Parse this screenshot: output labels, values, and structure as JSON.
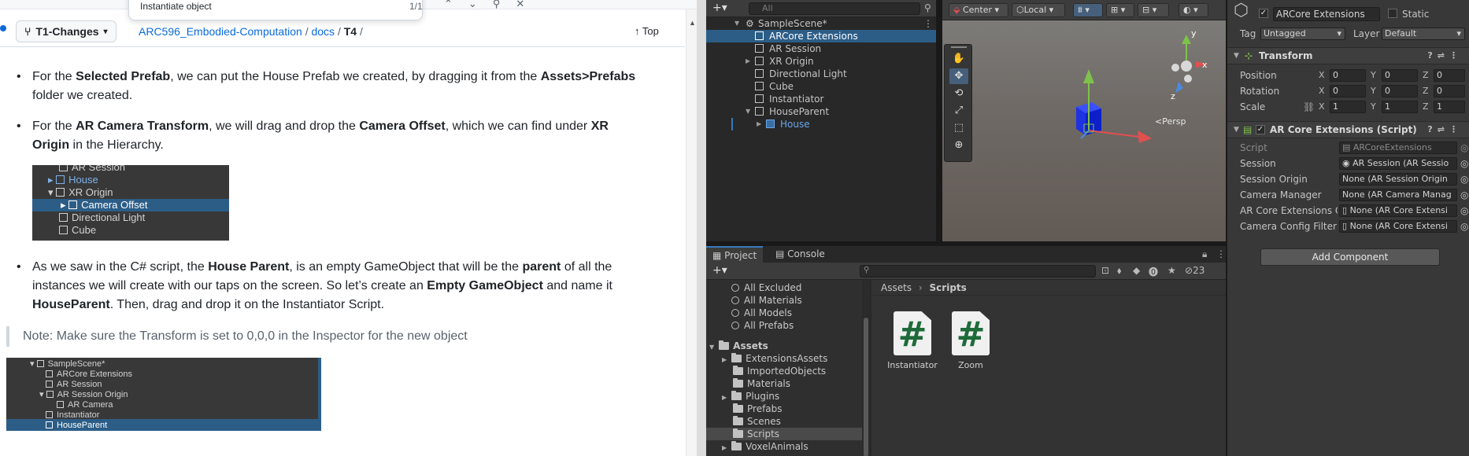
{
  "findbar": {
    "query": "Instantiate object",
    "count": "1/1"
  },
  "gh": {
    "branch": "T1-Changes",
    "repo": "ARC596_Embodied-Computation",
    "sep1": "/",
    "folder": "docs",
    "sep2": "/",
    "file": "T4",
    "sep3": "/",
    "top_label": "Top",
    "para1": {
      "pre": "For the ",
      "b1": "Selected Prefab",
      "mid": ", we can put the House Prefab we created, by dragging it from the ",
      "b2": "Assets>Prefabs",
      "post": " folder we created."
    },
    "para2": {
      "pre": "For the ",
      "b1": "AR Camera Transform",
      "mid": ", we will drag and drop the ",
      "b2": "Camera Offset",
      "mid2": ", which we can find under ",
      "b3": "XR Origin",
      "post": " in the Hierarchy."
    },
    "shot1": [
      "AR Session",
      "House",
      "XR Origin",
      "Camera Offset",
      "Directional Light",
      "Cube"
    ],
    "para3": {
      "pre": "As we saw in the C# script, the ",
      "b1": "House Parent",
      "mid": ", is an empty GameObject that will be the ",
      "b2": "parent",
      "mid2": " of all the instances we will create with our taps on the screen. So let’s create an ",
      "b3": "Empty GameObject",
      "mid3": " and name it ",
      "b4": "HouseParent",
      "post": ". Then, drag and drop it on the Instantiator Script."
    },
    "note": "Note: Make sure the Transform is set to 0,0,0 in the Inspector for the new object",
    "shot2": [
      "SampleScene*",
      "ARCore Extensions",
      "AR Session",
      "AR Session Origin",
      "AR Camera",
      "Instantiator",
      "HouseParent"
    ]
  },
  "hierarchy": {
    "search_placeholder": "All",
    "items": [
      "SampleScene*",
      "ARCore Extensions",
      "AR Session",
      "XR Origin",
      "Directional Light",
      "Cube",
      "Instantiator",
      "HouseParent",
      "House"
    ]
  },
  "scene": {
    "pivot": "Center",
    "space": "Local",
    "persp": "<Persp",
    "axis_x": "x",
    "axis_y": "y",
    "axis_z": "z"
  },
  "inspector": {
    "object_name": "ARCore Extensions",
    "static_label": "Static",
    "tag_label": "Tag",
    "tag_value": "Untagged",
    "layer_label": "Layer",
    "layer_value": "Default",
    "transform_title": "Transform",
    "position_label": "Position",
    "rotation_label": "Rotation",
    "scale_label": "Scale",
    "x": "X",
    "y": "Y",
    "z": "Z",
    "position": [
      "0",
      "0",
      "0"
    ],
    "rotation": [
      "0",
      "0",
      "0"
    ],
    "scale": [
      "1",
      "1",
      "1"
    ],
    "script_title": "AR Core Extensions (Script)",
    "props": [
      {
        "label": "Script",
        "value": "ARCoreExtensions"
      },
      {
        "label": "Session",
        "value": "AR Session (AR Sessio"
      },
      {
        "label": "Session Origin",
        "value": "None (AR Session Origin"
      },
      {
        "label": "Camera Manager",
        "value": "None (AR Camera Manag"
      },
      {
        "label": "AR Core Extensions C",
        "value": "None (AR Core Extensi"
      },
      {
        "label": "Camera Config Filter",
        "value": "None (AR Core Extensi"
      }
    ],
    "add_component": "Add Component"
  },
  "project": {
    "tab_project": "Project",
    "tab_console": "Console",
    "hidden_count": "23",
    "favorites": [
      "All Excluded",
      "All Materials",
      "All Models",
      "All Prefabs"
    ],
    "assets_root": "Assets",
    "folders": [
      "ExtensionsAssets",
      "ImportedObjects",
      "Materials",
      "Plugins",
      "Prefabs",
      "Scenes",
      "Scripts",
      "VoxelAnimals"
    ],
    "breadcrumb": [
      "Assets",
      "Scripts"
    ],
    "files": [
      "Instantiator",
      "Zoom"
    ]
  }
}
